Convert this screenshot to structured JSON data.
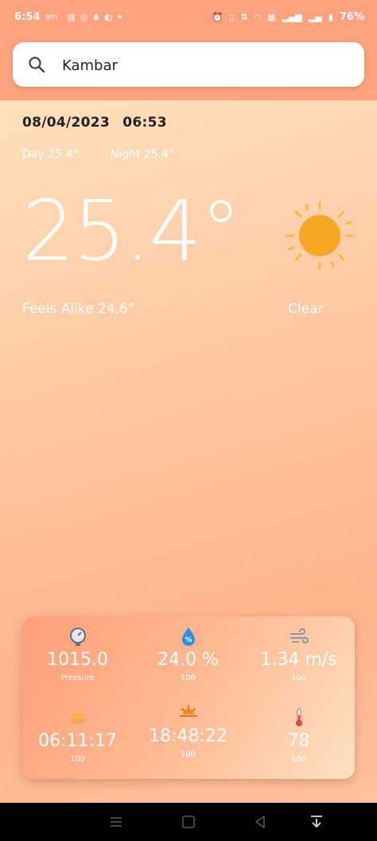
{
  "status_bar": {
    "time": "6:54",
    "ampm": "am",
    "battery": "76%"
  },
  "search": {
    "value": "Kambar",
    "placeholder": ""
  },
  "weather": {
    "date": "08/04/2023",
    "time": "06:53",
    "day_label": "Day 25.4°",
    "night_label": "Night 25.4°",
    "temperature": "25.4°",
    "feels_like": "Feels Alike 24.6°",
    "condition": "Clear"
  },
  "details": {
    "pressure": {
      "value": "1015.0",
      "label": "Pressure"
    },
    "humidity": {
      "value": "24.0 %",
      "label": "100"
    },
    "wind": {
      "value": "1.34 m/s",
      "label": "100"
    },
    "sunrise": {
      "value": "06:11:17",
      "label": "100"
    },
    "sunset": {
      "value": "18:48:22",
      "label": "100"
    },
    "temp": {
      "value": "78",
      "label": "100"
    }
  },
  "colors": {
    "header": "#ffa27e",
    "sun": "#f7a823",
    "humidity_icon": "#2b8fe8"
  }
}
